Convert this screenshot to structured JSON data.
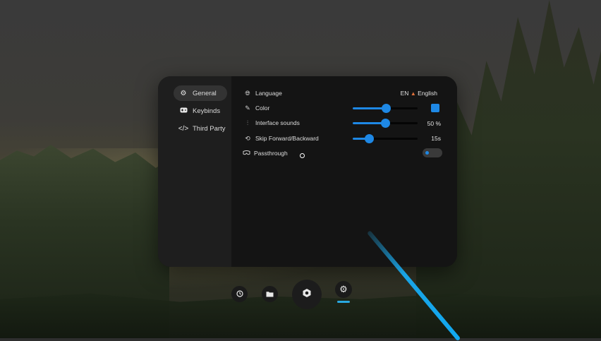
{
  "sidebar": {
    "items": [
      {
        "label": "General",
        "icon": "gear-icon",
        "active": true
      },
      {
        "label": "Keybinds",
        "icon": "gamepad-icon",
        "active": false
      },
      {
        "label": "Third Party",
        "icon": "code-icon",
        "active": false
      }
    ]
  },
  "settings": {
    "language": {
      "label": "Language",
      "code": "EN",
      "value": "English",
      "icon": "globe-icon"
    },
    "color": {
      "label": "Color",
      "icon": "brush-icon",
      "slider": 0.52,
      "swatch_color": "#1e88e5"
    },
    "interface_sounds": {
      "label": "Interface sounds",
      "icon": "waveform-icon",
      "slider": 0.5,
      "value": "50 %"
    },
    "skip": {
      "label": "Skip Forward/Backward",
      "icon": "skip-icon",
      "slider": 0.25,
      "value": "15s"
    },
    "passthrough": {
      "label": "Passthrough",
      "icon": "headset-icon",
      "enabled": false
    }
  },
  "dock": {
    "items": [
      {
        "icon": "clock-icon"
      },
      {
        "icon": "folder-icon"
      },
      {
        "icon": "hexagon-icon"
      },
      {
        "icon": "gear-icon",
        "active": true
      }
    ]
  },
  "colors": {
    "accent": "#1e88e5",
    "beam": "#19a4e6"
  }
}
